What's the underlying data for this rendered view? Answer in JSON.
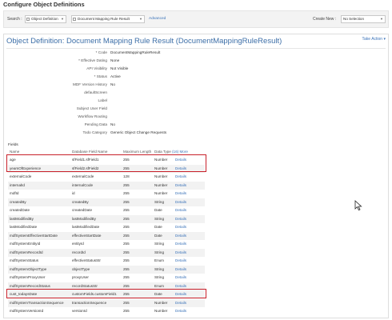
{
  "page_title": "Configure Object Definitions",
  "toolbar": {
    "search_label": "Search :",
    "object_select": "Object Definition",
    "record_select": "Document Mapping Rule Result",
    "advanced_link": "Advanced",
    "create_new_label": "Create New :",
    "create_new_select": "No Selection"
  },
  "panel": {
    "title": "Object Definition: Document Mapping Rule Result (DocumentMappingRuleResult)",
    "take_action": "Take Action ▾"
  },
  "properties": [
    {
      "label": "* Code",
      "value": "DocumentMappingRuleResult"
    },
    {
      "label": "* Effective Dating",
      "value": "None"
    },
    {
      "label": "API Visibility",
      "value": "Not Visible"
    },
    {
      "label": "* Status",
      "value": "Active"
    },
    {
      "label": "MDF Version History",
      "value": "No"
    },
    {
      "label": "defaultScreen",
      "value": ""
    },
    {
      "label": "Label",
      "value": ""
    },
    {
      "label": "Subject User Field",
      "value": ""
    },
    {
      "label": "Workflow Routing",
      "value": ""
    },
    {
      "label": "Pending Data",
      "value": "No"
    },
    {
      "label": "Todo Category",
      "value": "Generic Object Change Requests"
    }
  ],
  "fields": {
    "section_label": "Fields",
    "headers": {
      "name": "Name",
      "db": "Database Field Name",
      "len": "Maximum Length",
      "type": "Data Type",
      "more": "(16) More"
    },
    "rows": [
      {
        "name": "age",
        "db": "sfField1.sfField1",
        "len": "255",
        "type": "Number",
        "details": "Details"
      },
      {
        "name": "yearsOfExperience",
        "db": "sfField2.sfField2",
        "len": "255",
        "type": "Number",
        "details": "Details"
      },
      {
        "name": "externalCode",
        "db": "externalCode",
        "len": "128",
        "type": "Number",
        "details": "Details"
      },
      {
        "name": "internalId",
        "db": "internalCode",
        "len": "255",
        "type": "Number",
        "details": "Details"
      },
      {
        "name": "mdfId",
        "db": "id",
        "len": "255",
        "type": "Number",
        "details": "Details"
      },
      {
        "name": "createdBy",
        "db": "createdBy",
        "len": "255",
        "type": "String",
        "details": "Details"
      },
      {
        "name": "createdDate",
        "db": "createdDate",
        "len": "255",
        "type": "Date",
        "details": "Details"
      },
      {
        "name": "lastModifiedBy",
        "db": "lastModifiedBy",
        "len": "255",
        "type": "String",
        "details": "Details"
      },
      {
        "name": "lastModifiedDate",
        "db": "lastModifiedDate",
        "len": "255",
        "type": "Date",
        "details": "Details"
      },
      {
        "name": "mdfSystemEffectiveStartDate",
        "db": "effectiveStartDate",
        "len": "255",
        "type": "Date",
        "details": "Details"
      },
      {
        "name": "mdfSystemEntityId",
        "db": "entityId",
        "len": "255",
        "type": "String",
        "details": "Details"
      },
      {
        "name": "mdfSystemRecordId",
        "db": "recordId",
        "len": "255",
        "type": "String",
        "details": "Details"
      },
      {
        "name": "mdfSystemStatus",
        "db": "effectiveStatusStr",
        "len": "255",
        "type": "Enum",
        "details": "Details"
      },
      {
        "name": "mdfSystemObjectType",
        "db": "objectType",
        "len": "255",
        "type": "String",
        "details": "Details"
      },
      {
        "name": "mdfSystemProxyUser",
        "db": "proxyUser",
        "len": "255",
        "type": "String",
        "details": "Details"
      },
      {
        "name": "mdfSystemRecordStatus",
        "db": "recordStatusStr",
        "len": "255",
        "type": "Enum",
        "details": "Details"
      },
      {
        "name": "mdfSystemEffectiveEndDate",
        "db": "effectiveEndDate",
        "len": "255",
        "type": "Date",
        "details": "Details"
      },
      {
        "name": "mdfSystemTransactionSequence",
        "db": "transactionSequence",
        "len": "255",
        "type": "Number",
        "details": "Details"
      },
      {
        "name": "mdfSystemVersionId",
        "db": "versionId",
        "len": "255",
        "type": "Number",
        "details": "Details"
      },
      {
        "name": "cust_todaysDate",
        "db": "customFields.customField1",
        "len": "255",
        "type": "Date",
        "details": "Details"
      }
    ]
  },
  "colors": {
    "title_blue": "#3d6fa8",
    "link_blue": "#3b73b9",
    "highlight_red": "#c8202a"
  },
  "cursor_icon": "mouse-pointer-icon"
}
